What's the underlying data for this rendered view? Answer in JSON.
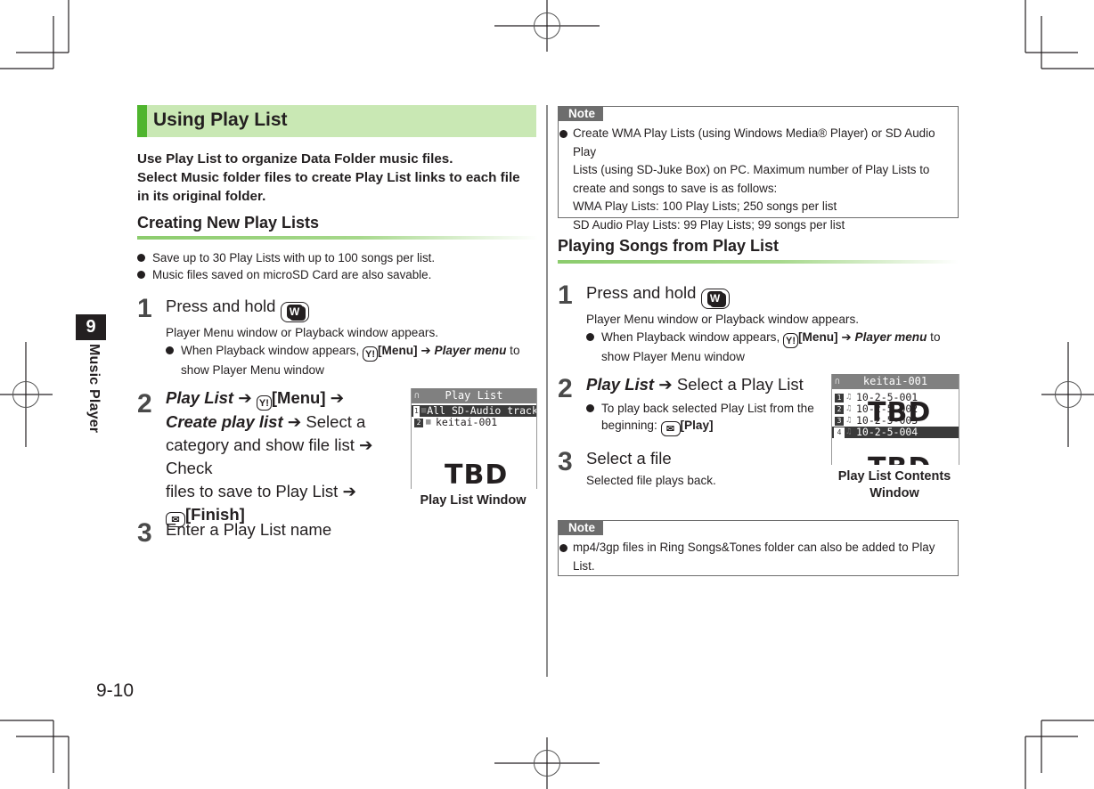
{
  "chapter": {
    "number": "9",
    "title": "Music Player"
  },
  "page_number": "9-10",
  "section": {
    "title": "Using Play List",
    "intro": [
      "Use Play List to organize Data Folder music files.",
      "Select Music folder files to create Play List links to each file",
      "in its original folder."
    ]
  },
  "creating": {
    "heading": "Creating New Play Lists",
    "bullets": [
      "Save up to 30 Play Lists with up to 100 songs per list.",
      "Music files saved on microSD Card are also savable."
    ],
    "steps": [
      {
        "num": "1",
        "title": "Press and hold",
        "key_icon": "W",
        "desc": "Player Menu window or Playback window appears.",
        "bullet": {
          "pre": "When Playback window appears,",
          "key_icon": "Y!",
          "menu": "[Menu]",
          "arrow": "➔",
          "em": "Player menu",
          "post": "to",
          "line2": "show Player Menu window"
        }
      },
      {
        "num": "2",
        "lines": {
          "em1": "Play List",
          "arrow": "➔",
          "key_icon": "Y!",
          "menu": "[Menu]",
          "em2": "Create play list",
          "t1": "Select a",
          "t2": "category and show file list",
          "t3": "Check",
          "t4": "files to save to Play List",
          "key2_icon": "mail",
          "finish": "[Finish]"
        }
      },
      {
        "num": "3",
        "title": "Enter a Play List name"
      }
    ],
    "screen": {
      "title": "Play List",
      "rows": [
        {
          "n": "1",
          "text": "All SD-Audio tracks",
          "selected": true
        },
        {
          "n": "2",
          "text": "keitai-001",
          "selected": false
        }
      ],
      "placeholder": "TBD",
      "caption": "Play List Window"
    }
  },
  "note1": {
    "label": "Note",
    "lines": [
      "Create WMA Play Lists (using Windows Media® Player) or SD Audio Play",
      "Lists (using SD-Juke Box) on PC. Maximum number of Play Lists to",
      "create and songs to save is as follows:",
      "WMA Play Lists: 100 Play Lists; 250 songs per list",
      "SD Audio Play Lists: 99 Play Lists; 99 songs per list"
    ]
  },
  "playing": {
    "heading": "Playing Songs from Play List",
    "steps": [
      {
        "num": "1",
        "title": "Press and hold",
        "key_icon": "W",
        "desc": "Player Menu window or Playback window appears.",
        "bullet": {
          "pre": "When Playback window appears,",
          "key_icon": "Y!",
          "menu": "[Menu]",
          "arrow": "➔",
          "em": "Player menu",
          "post": "to",
          "line2": "show Player Menu window"
        }
      },
      {
        "num": "2",
        "em": "Play List",
        "arrow": "➔",
        "title": "Select a Play List",
        "bullet": {
          "line1": "To play back selected Play List from the",
          "pre2": "beginning:",
          "key_icon": "mail",
          "action": "[Play]"
        }
      },
      {
        "num": "3",
        "title": "Select a file",
        "desc": "Selected file plays back."
      }
    ],
    "screen": {
      "title": "keitai-001",
      "rows": [
        {
          "n": "1",
          "text": "10-2-5-001",
          "selected": false
        },
        {
          "n": "2",
          "text": "10-2-5-002",
          "selected": false
        },
        {
          "n": "3",
          "text": "10-2-5-003",
          "selected": false
        },
        {
          "n": "4",
          "text": "10-2-5-004",
          "selected": true
        }
      ],
      "placeholder": "TBD",
      "caption_line1": "Play List Contents",
      "caption_line2": "Window"
    }
  },
  "note2": {
    "label": "Note",
    "lines": [
      "mp4/3gp files in Ring Songs&Tones folder can also be added to Play",
      "List."
    ]
  }
}
